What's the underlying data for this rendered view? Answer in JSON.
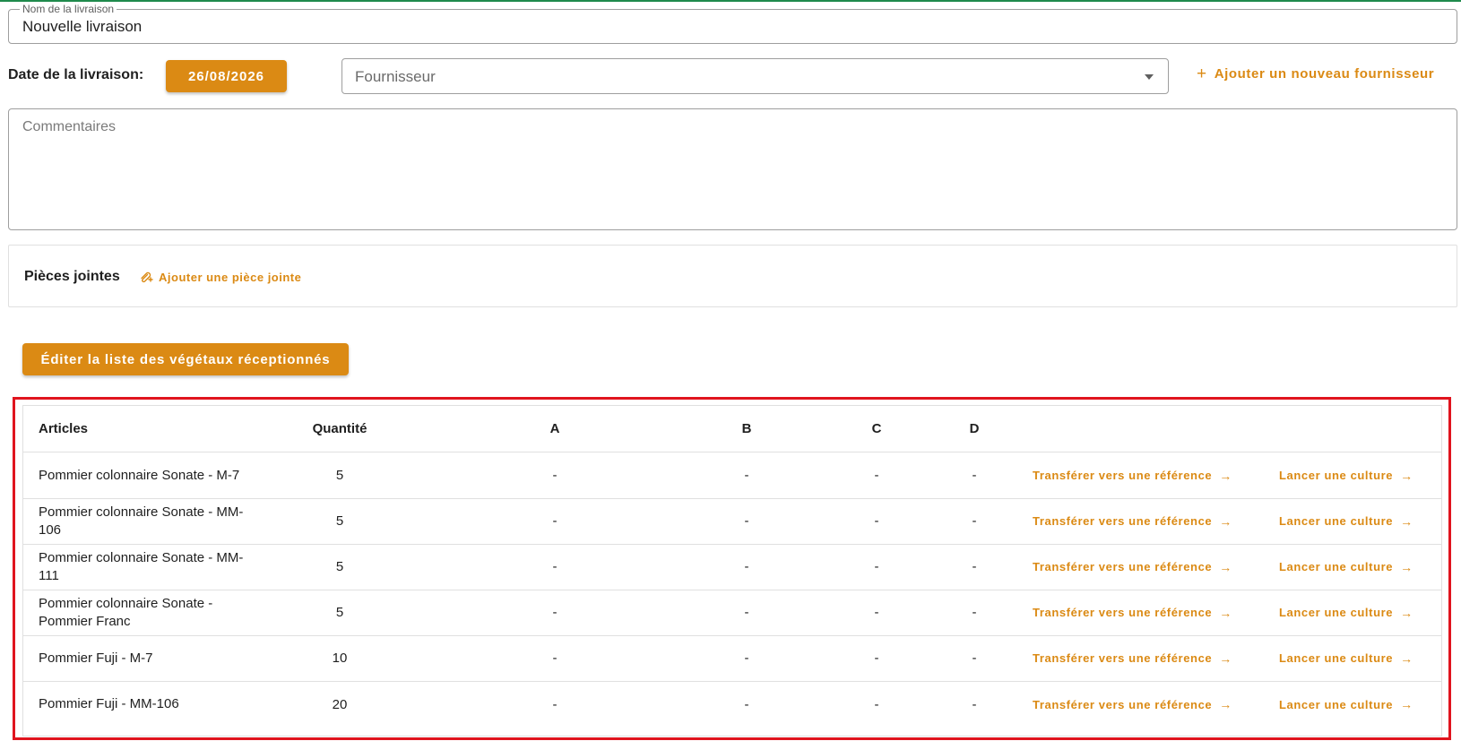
{
  "form": {
    "name_label": "Nom de la livraison",
    "name_value": "Nouvelle livraison",
    "date_label": "Date de la livraison:",
    "date_value": "26/08/2026",
    "supplier_placeholder": "Fournisseur",
    "add_supplier_label": "Ajouter un nouveau fournisseur",
    "comments_placeholder": "Commentaires"
  },
  "attachments": {
    "title": "Pièces jointes",
    "add_label": "Ajouter une pièce jointe"
  },
  "edit_button_label": "Éditer la liste des végétaux réceptionnés",
  "table": {
    "headers": {
      "article": "Articles",
      "quantity": "Quantité",
      "a": "A",
      "b": "B",
      "c": "C",
      "d": "D"
    },
    "transfer_label": "Transférer vers une référence",
    "culture_label": "Lancer une culture",
    "arrow_glyph": "→",
    "rows": [
      {
        "article": "Pommier colonnaire Sonate - M-7",
        "quantity": "5",
        "a": "-",
        "b": "-",
        "c": "-",
        "d": "-"
      },
      {
        "article": "Pommier colonnaire Sonate - MM-106",
        "quantity": "5",
        "a": "-",
        "b": "-",
        "c": "-",
        "d": "-"
      },
      {
        "article": "Pommier colonnaire Sonate - MM-111",
        "quantity": "5",
        "a": "-",
        "b": "-",
        "c": "-",
        "d": "-"
      },
      {
        "article": "Pommier colonnaire Sonate - Pommier Franc",
        "quantity": "5",
        "a": "-",
        "b": "-",
        "c": "-",
        "d": "-"
      },
      {
        "article": "Pommier Fuji - M-7",
        "quantity": "10",
        "a": "-",
        "b": "-",
        "c": "-",
        "d": "-"
      },
      {
        "article": "Pommier Fuji - MM-106",
        "quantity": "20",
        "a": "-",
        "b": "-",
        "c": "-",
        "d": "-"
      }
    ]
  },
  "colors": {
    "accent": "#db8a14",
    "highlight_border": "#e0141e",
    "top_bar": "#1f8a4c"
  }
}
